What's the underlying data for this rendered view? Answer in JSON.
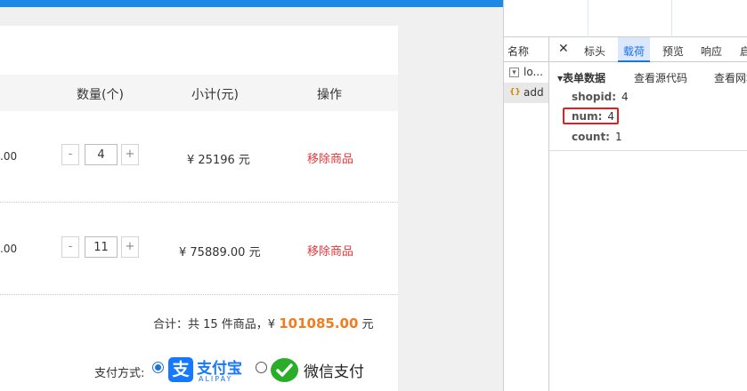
{
  "cart": {
    "headers": {
      "quantity": "数量(个)",
      "subtotal": "小计(元)",
      "action": "操作"
    },
    "rows": [
      {
        "price_fragment": ".00",
        "minus": "-",
        "plus": "+",
        "quantity": "4",
        "subtotal": "¥  25196 元",
        "remove": "移除商品"
      },
      {
        "price_fragment": ".00",
        "minus": "-",
        "plus": "+",
        "quantity": "11",
        "subtotal": "¥  75889.00 元",
        "remove": "移除商品"
      }
    ],
    "summary": {
      "prefix": "合计：共 15 件商品，¥ ",
      "total": "101085.00",
      "suffix": " 元"
    },
    "payment": {
      "label": "支付方式:",
      "alipay_name": "支付宝",
      "alipay_sub": "ALIPAY",
      "alipay_glyph": "支",
      "wechat_name": "微信支付",
      "selected": "alipay"
    },
    "colors": {
      "accent_bar": "#1e88e5",
      "remove_link": "#e4393c",
      "total": "#f37b1d",
      "alipay": "#1677ff",
      "wechat": "#2aae2a"
    }
  },
  "devtools": {
    "name_header": "名称",
    "requests": [
      {
        "label": "lo...",
        "icon": "document-icon",
        "selected": false
      },
      {
        "label": "add",
        "icon": "braces-icon",
        "selected": true
      }
    ],
    "close_symbol": "✕",
    "tabs": [
      "标头",
      "载荷",
      "预览",
      "响应",
      "启"
    ],
    "active_tab": "载荷",
    "payload": {
      "section_title": "▾表单数据",
      "view_source": "查看源代码",
      "view_url": "查看网址",
      "fields": [
        {
          "key": "shopid:",
          "value": "4"
        },
        {
          "key": "num:",
          "value": "4"
        },
        {
          "key": "count:",
          "value": "1"
        }
      ],
      "highlight_color": "#e02020"
    }
  }
}
